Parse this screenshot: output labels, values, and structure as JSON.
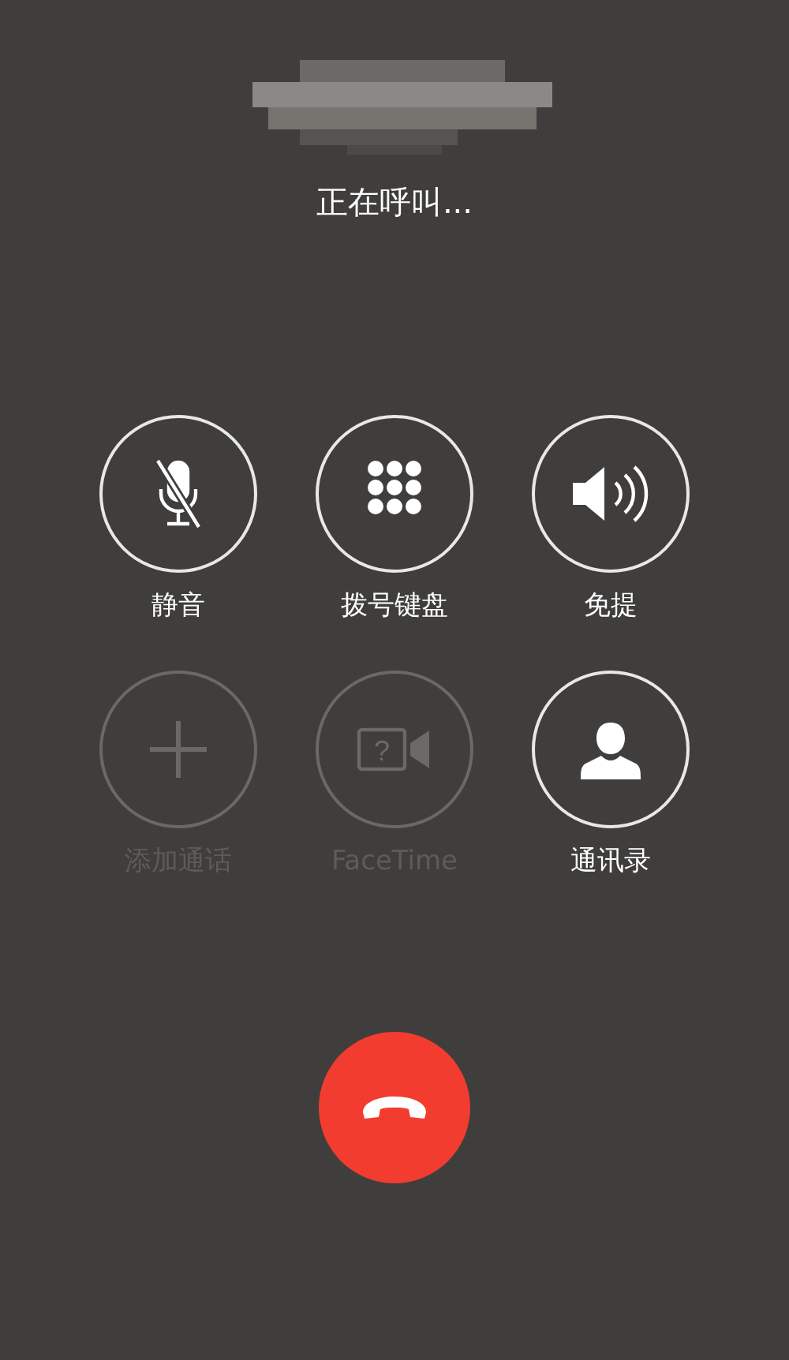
{
  "caller": {
    "kind": "redacted"
  },
  "status": "正在呼叫...",
  "buttons": [
    {
      "kind": "mute",
      "label": "静音",
      "disabled": false
    },
    {
      "kind": "keypad",
      "label": "拨号键盘",
      "disabled": false
    },
    {
      "kind": "speaker",
      "label": "免提",
      "disabled": false
    },
    {
      "kind": "add",
      "label": "添加通话",
      "disabled": true
    },
    {
      "kind": "facetime",
      "label": "FaceTime",
      "disabled": true,
      "icon_text": "?"
    },
    {
      "kind": "contacts",
      "label": "通讯录",
      "disabled": false
    }
  ],
  "end_call": {
    "kind": "hangup"
  }
}
